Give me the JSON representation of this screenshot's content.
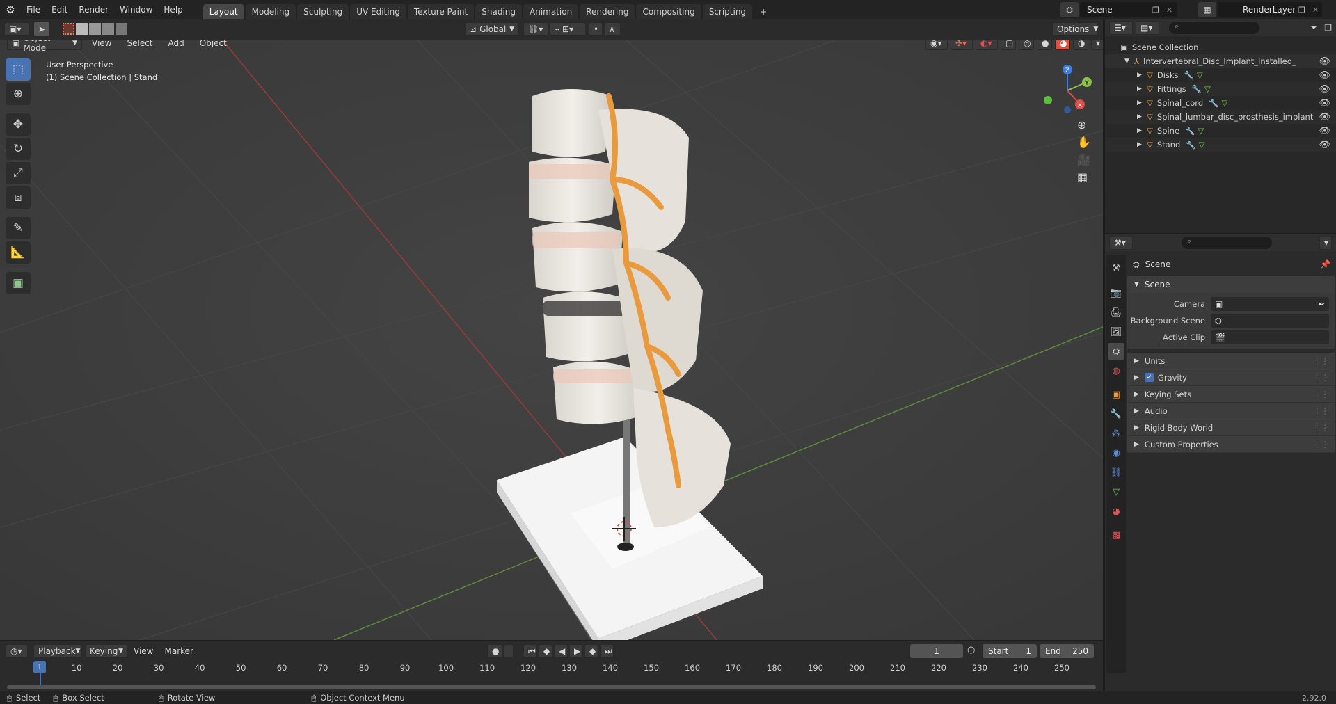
{
  "top_menu": [
    "File",
    "Edit",
    "Render",
    "Window",
    "Help"
  ],
  "workspaces": [
    "Layout",
    "Modeling",
    "Sculpting",
    "UV Editing",
    "Texture Paint",
    "Shading",
    "Animation",
    "Rendering",
    "Compositing",
    "Scripting"
  ],
  "active_workspace": "Layout",
  "scene_name": "Scene",
  "view_layer": "RenderLayer",
  "viewport_header": {
    "mode": "Object Mode",
    "menus": [
      "View",
      "Select",
      "Add",
      "Object"
    ],
    "transform_orientation": "Global",
    "options_label": "Options"
  },
  "viewport_overlay": {
    "view_name": "User Perspective",
    "context": "(1) Scene Collection | Stand"
  },
  "gizmo": {
    "z": "Z",
    "y": "Y",
    "x": "X"
  },
  "outliner": {
    "root": "Scene Collection",
    "collection": "Intervertebral_Disc_Implant_Installed_on_Sp",
    "objects": [
      {
        "name": "Disks",
        "has_modifier": true,
        "has_mesh": true
      },
      {
        "name": "Fittings",
        "has_modifier": true,
        "has_mesh": true
      },
      {
        "name": "Spinal_cord",
        "has_modifier": true,
        "has_mesh": true
      },
      {
        "name": "Spinal_lumbar_disc_prosthesis_implant",
        "has_modifier": false,
        "has_mesh": false
      },
      {
        "name": "Spine",
        "has_modifier": true,
        "has_mesh": true
      },
      {
        "name": "Stand",
        "has_modifier": true,
        "has_mesh": true
      }
    ]
  },
  "properties": {
    "context_title": "Scene",
    "panel_title": "Scene",
    "fields": [
      {
        "label": "Camera",
        "icon": "camera-icon"
      },
      {
        "label": "Background Scene",
        "icon": "scene-icon"
      },
      {
        "label": "Active Clip",
        "icon": "clip-icon"
      }
    ],
    "subpanels": [
      {
        "label": "Units",
        "checkbox": false
      },
      {
        "label": "Gravity",
        "checkbox": true
      },
      {
        "label": "Keying Sets",
        "checkbox": false
      },
      {
        "label": "Audio",
        "checkbox": false
      },
      {
        "label": "Rigid Body World",
        "checkbox": false
      },
      {
        "label": "Custom Properties",
        "checkbox": false
      }
    ]
  },
  "timeline": {
    "menus": [
      "Playback",
      "Keying",
      "View",
      "Marker"
    ],
    "current_frame": "1",
    "start_label": "Start",
    "start": "1",
    "end_label": "End",
    "end": "250",
    "ticks": [
      "1",
      "10",
      "20",
      "30",
      "40",
      "50",
      "60",
      "70",
      "80",
      "90",
      "100",
      "110",
      "120",
      "130",
      "140",
      "150",
      "160",
      "170",
      "180",
      "190",
      "200",
      "210",
      "220",
      "230",
      "240",
      "250"
    ]
  },
  "status_bar": {
    "items": [
      "Select",
      "Box Select",
      "Rotate View",
      "Object Context Menu"
    ],
    "version": "2.92.0"
  },
  "colors": {
    "accent": "#4772b3",
    "axis_x": "#e24b4b",
    "axis_y": "#8bc34a",
    "axis_z": "#3e7de0",
    "object_orange": "#e89a3c"
  }
}
